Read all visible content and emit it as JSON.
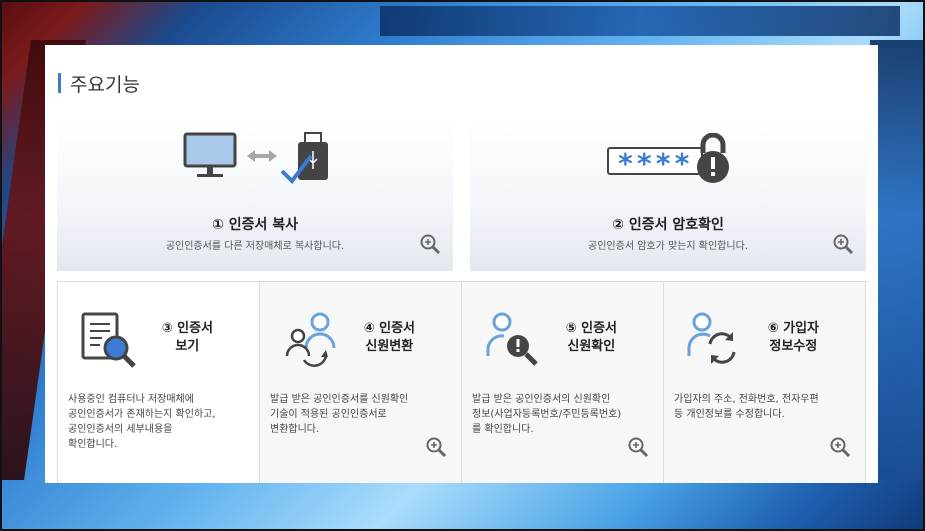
{
  "section_title": "주요기능",
  "top_cards": [
    {
      "title": "① 인증서 복사",
      "desc": "공인인증서를 다른 저장매체로 복사합니다."
    },
    {
      "title": "② 인증서 암호확인",
      "desc": "공인인증서 암호가 맞는지 확인합니다."
    }
  ],
  "bottom_cards": [
    {
      "title_line1": "③ 인증서",
      "title_line2": "보기",
      "desc_lines": [
        "사용중인 컴퓨터나 저장매체에",
        "공인인증서가 존재하는지 확인하고,",
        "공인인증서의 세부내용을",
        "확인합니다."
      ]
    },
    {
      "title_line1": "④ 인증서",
      "title_line2": "신원변환",
      "desc_lines": [
        "발급 받은 공인인증서를 신원확인",
        "기술이 적용된 공인인증서로",
        "변환합니다."
      ]
    },
    {
      "title_line1": "⑤ 인증서",
      "title_line2": "신원확인",
      "desc_lines": [
        "발급 받은 공인인증서의 신원확인",
        "정보(사업자등록번호/주민등록번호)",
        "를 확인합니다."
      ]
    },
    {
      "title_line1": "⑥ 가입자",
      "title_line2": "정보수정",
      "desc_lines": [
        "가입자의 주소, 전화번호, 전자우편",
        "등 개인정보를 수정합니다."
      ]
    }
  ],
  "password_mask": "****",
  "colors": {
    "accent": "#3a7bd5",
    "icon_blue": "#6aa3d9",
    "icon_dark": "#444444"
  }
}
